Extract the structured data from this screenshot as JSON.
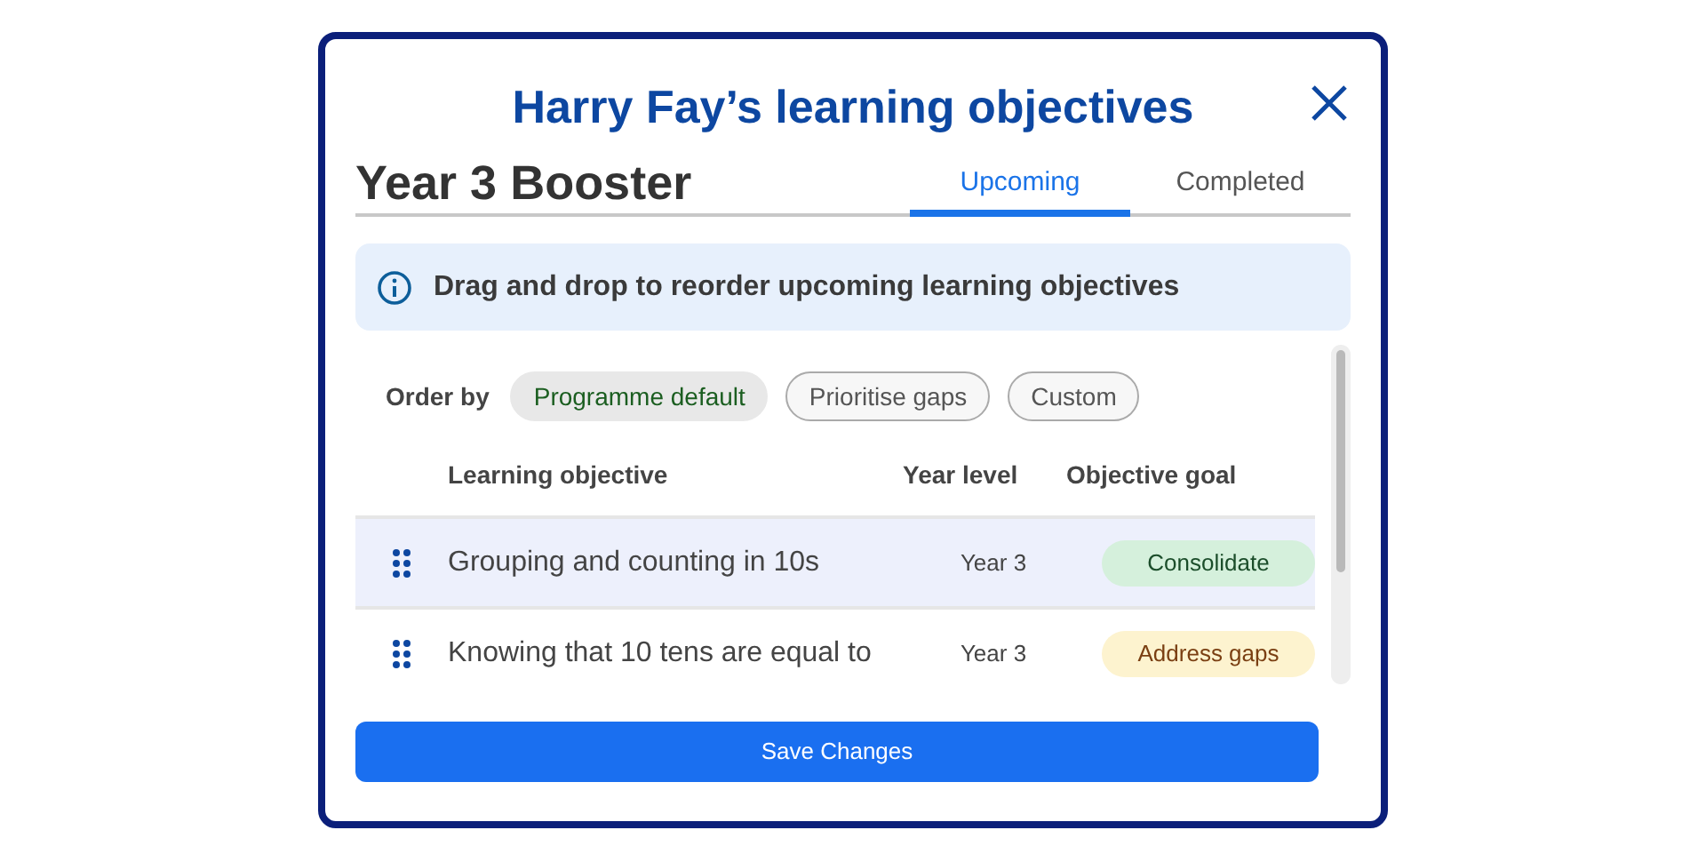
{
  "dialog": {
    "title": "Harry Fay’s learning objectives",
    "programme": "Year 3 Booster"
  },
  "tabs": [
    {
      "label": "Upcoming",
      "selected": true
    },
    {
      "label": "Completed",
      "selected": false
    }
  ],
  "info": "Drag and drop to reorder upcoming learning objectives",
  "order_by": {
    "label": "Order by",
    "options": [
      {
        "label": "Programme default",
        "selected": true
      },
      {
        "label": "Prioritise gaps",
        "selected": false
      },
      {
        "label": "Custom",
        "selected": false
      }
    ]
  },
  "table": {
    "columns": [
      "Learning objective",
      "Year level",
      "Objective goal"
    ],
    "rows": [
      {
        "objective": "Grouping and counting in 10s",
        "year": "Year 3",
        "goal": "Consolidate",
        "kind": "consolidate",
        "selected": true
      },
      {
        "objective": "Knowing that 10 tens are equal to",
        "year": "Year 3",
        "goal": "Address gaps",
        "kind": "gaps",
        "selected": false
      }
    ]
  },
  "save_button": "Save Changes"
}
